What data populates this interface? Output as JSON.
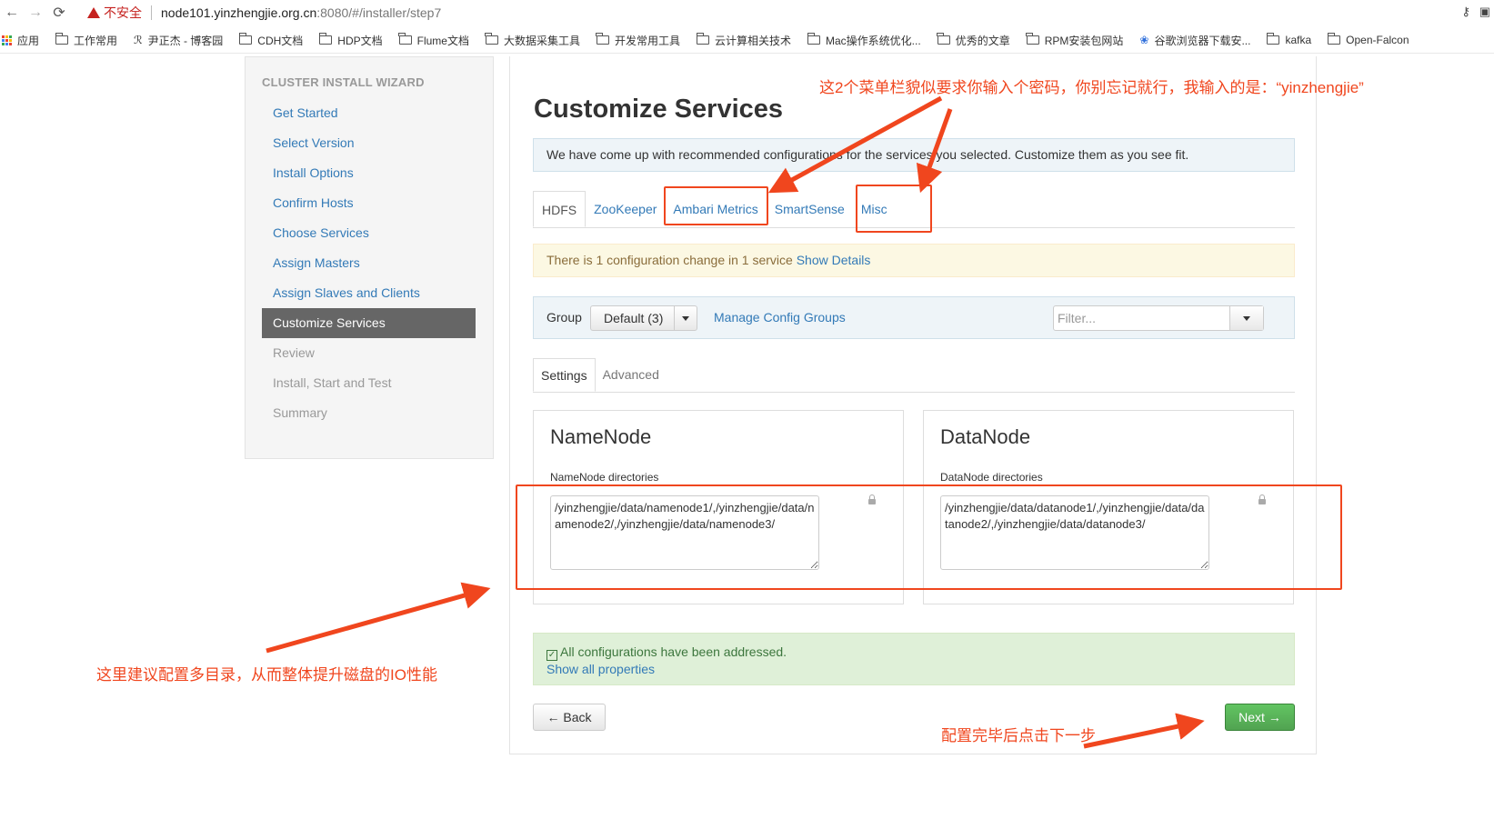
{
  "browser": {
    "security_label": "不安全",
    "url_host": "node101.yinzhengjie.org.cn",
    "url_rest": ":8080/#/installer/step7",
    "bookmarks": [
      "应用",
      "工作常用",
      "尹正杰 - 博客园",
      "CDH文档",
      "HDP文档",
      "Flume文档",
      "大数据采集工具",
      "开发常用工具",
      "云计算相关技术",
      "Mac操作系统优化...",
      "优秀的文章",
      "RPM安装包网站",
      "谷歌浏览器下载安...",
      "kafka",
      "Open-Falcon"
    ]
  },
  "sidebar": {
    "title": "CLUSTER INSTALL WIZARD",
    "steps": [
      {
        "label": "Get Started",
        "state": "done"
      },
      {
        "label": "Select Version",
        "state": "done"
      },
      {
        "label": "Install Options",
        "state": "done"
      },
      {
        "label": "Confirm Hosts",
        "state": "done"
      },
      {
        "label": "Choose Services",
        "state": "done"
      },
      {
        "label": "Assign Masters",
        "state": "done"
      },
      {
        "label": "Assign Slaves and Clients",
        "state": "done"
      },
      {
        "label": "Customize Services",
        "state": "active"
      },
      {
        "label": "Review",
        "state": "disabled"
      },
      {
        "label": "Install, Start and Test",
        "state": "disabled"
      },
      {
        "label": "Summary",
        "state": "disabled"
      }
    ]
  },
  "main": {
    "title": "Customize Services",
    "info": "We have come up with recommended configurations for the services you selected. Customize them as you see fit.",
    "tabs": [
      "HDFS",
      "ZooKeeper",
      "Ambari Metrics",
      "SmartSense",
      "Misc"
    ],
    "active_tab": "HDFS",
    "config_change": {
      "text": "There is 1 configuration change in 1 service",
      "link": "Show Details"
    },
    "group": {
      "label": "Group",
      "value": "Default (3)",
      "manage_link": "Manage Config Groups",
      "filter_placeholder": "Filter..."
    },
    "subtabs": [
      "Settings",
      "Advanced"
    ],
    "namenode": {
      "title": "NameNode",
      "field_label": "NameNode directories",
      "value": "/yinzhengjie/data/namenode1/,/yinzhengjie/data/namenode2/,/yinzhengjie/data/namenode3/"
    },
    "datanode": {
      "title": "DataNode",
      "field_label": "DataNode directories",
      "value": "/yinzhengjie/data/datanode1/,/yinzhengjie/data/datanode2/,/yinzhengjie/data/datanode3/"
    },
    "addressed": {
      "text": "All configurations have been addressed.",
      "link": "Show all properties"
    },
    "back_label": "← Back",
    "next_label": "Next →"
  },
  "annotations": {
    "password_note": "这2个菜单栏貌似要求你输入个密码，你别忘记就行，我输入的是：“yinzhengjie”",
    "dirs_note": "这里建议配置多目录，从而整体提升磁盘的IO性能",
    "next_note": "配置完毕后点击下一步",
    "color": "#f0461e"
  }
}
